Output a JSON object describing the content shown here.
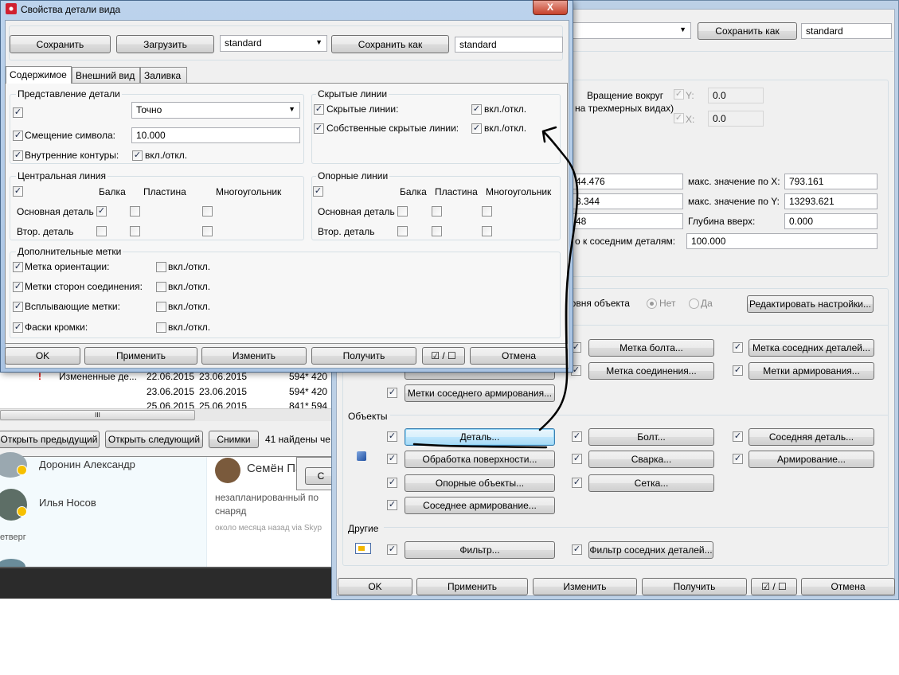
{
  "background_window": {
    "rows": [
      {
        "flag": "!",
        "name": "Измененные де...",
        "date1": "22.06.2015",
        "date2": "23.06.2015",
        "size": "594* 420"
      },
      {
        "flag": "",
        "name": "",
        "date1": "23.06.2015",
        "date2": "23.06.2015",
        "size": "594* 420"
      },
      {
        "flag": "",
        "name": "",
        "date1": "25.06.2015",
        "date2": "25.06.2015",
        "size": "841* 594"
      }
    ],
    "scroll_grip": "III",
    "buttons": {
      "prev": "Открыть предыдущий",
      "next": "Открыть следующий",
      "snapshots": "Снимки"
    },
    "found_text": "41 найдены че"
  },
  "skype": {
    "contacts": [
      {
        "name": "Доронин Александр"
      },
      {
        "name": "Илья Носов"
      }
    ],
    "day_label": "етверг",
    "message": {
      "author": "Семён Па",
      "text1": "незапланированный по",
      "text2": "снаряд",
      "meta": "около месяца назад via Skyp"
    },
    "partial_button": "С"
  },
  "right_window": {
    "save_as_label": "Сохранить как",
    "save_as_value": "standard",
    "rotation": {
      "label1": "Вращение вокруг",
      "label2": "на трехмерных видах)",
      "y_label": "Y:",
      "y_value": "0.0",
      "x_label": "X:",
      "x_value": "0.0"
    },
    "extents": {
      "min_x": "44.476",
      "max_x_label": "макс. значение по X:",
      "max_x": "793.161",
      "min_y": "3.344",
      "max_y_label": "макс. значение по Y:",
      "max_y": "13293.621",
      "depth_down": "48",
      "depth_up_label": "Глубина вверх:",
      "depth_up": "0.000",
      "neighbor_label": "о к соседним деталям:",
      "neighbor": "100.000"
    },
    "object_level": {
      "label": "ровня объекта",
      "no": "Нет",
      "yes": "Да",
      "edit": "Редактировать настройки..."
    },
    "marks": {
      "bolt": "Метка болта...",
      "neighbor_parts": "Метка соседних деталей...",
      "connection": "Метка соединения...",
      "reinforcement": "Метки армирования...",
      "neighbor_reinf": "Метки соседнего армирования..."
    },
    "objects_header": "Объекты",
    "objects": {
      "part": "Деталь...",
      "bolt": "Болт...",
      "neighbor_part": "Соседняя деталь...",
      "surface": "Обработка поверхности...",
      "weld": "Сварка...",
      "reinforcement": "Армирование...",
      "reference": "Опорные объекты...",
      "grid": "Сетка...",
      "neighbor_reinf": "Соседнее армирование..."
    },
    "other_header": "Другие",
    "other": {
      "filter": "Фильтр...",
      "neighbor_filter": "Фильтр соседних деталей..."
    },
    "bottom": {
      "ok": "OK",
      "apply": "Применить",
      "modify": "Изменить",
      "get": "Получить",
      "toggle": "☑ / ☐",
      "cancel": "Отмена"
    }
  },
  "dialog": {
    "title": "Свойства детали вида",
    "close": "X",
    "top": {
      "save": "Сохранить",
      "load": "Загрузить",
      "preset": "standard",
      "save_as": "Сохранить как",
      "save_as_value": "standard"
    },
    "tabs": [
      "Содержимое",
      "Внешний вид",
      "Заливка"
    ],
    "representation": {
      "title": "Представление детали",
      "mode": "Точно",
      "offset_label": "Смещение символа:",
      "offset": "10.000",
      "inner_label": "Внутренние контуры:",
      "onoff": "вкл./откл."
    },
    "hidden": {
      "title": "Скрытые линии",
      "hidden_label": "Скрытые линии:",
      "own_label": "Собственные скрытые линии:",
      "onoff": "вкл./откл."
    },
    "center": {
      "title": "Центральная линия",
      "cols": [
        "Балка",
        "Пластина",
        "Многоугольник"
      ],
      "main": "Основная деталь",
      "secondary": "Втор. деталь"
    },
    "reference": {
      "title": "Опорные линии",
      "cols": [
        "Балка",
        "Пластина",
        "Многоугольник"
      ],
      "main": "Основная деталь",
      "secondary": "Втор. деталь"
    },
    "extra": {
      "title": "Дополнительные метки",
      "items": [
        "Метка ориентации:",
        "Метки сторон соединения:",
        "Всплывающие метки:",
        "Фаски кромки:"
      ],
      "onoff": "вкл./откл."
    },
    "bottom": {
      "ok": "OK",
      "apply": "Применить",
      "modify": "Изменить",
      "get": "Получить",
      "toggle": "☑ / ☐",
      "cancel": "Отмена"
    }
  }
}
